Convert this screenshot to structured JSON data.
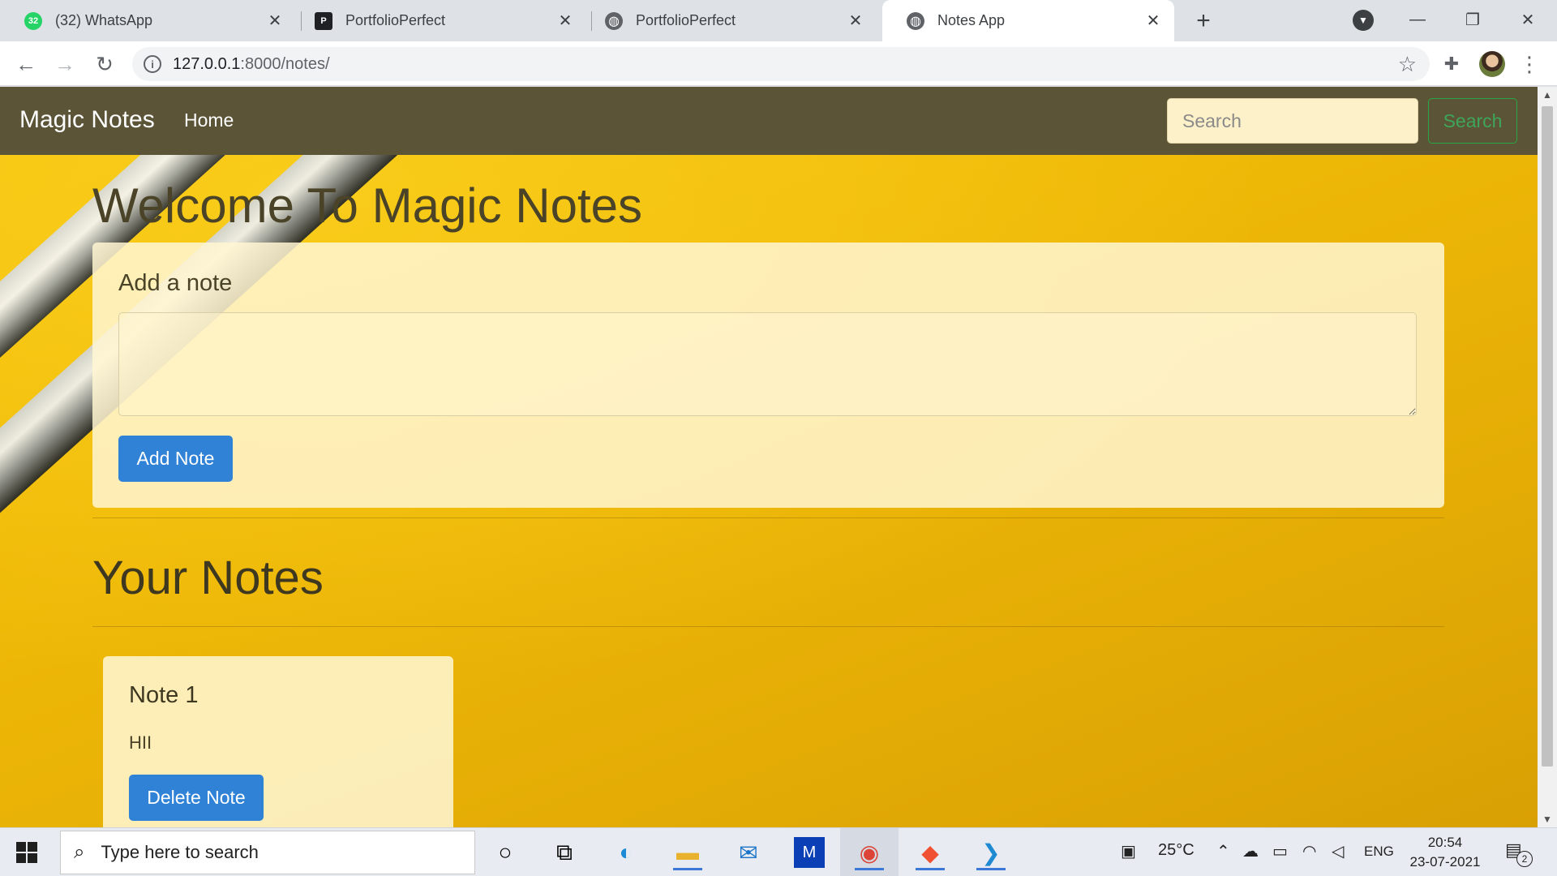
{
  "browser": {
    "tabs": [
      {
        "title": "(32) WhatsApp",
        "badge": "32",
        "favicon": "whatsapp-icon",
        "favicon_color": "#25d366"
      },
      {
        "title": "PortfolioPerfect",
        "badge": "P",
        "favicon": "portfolioperfect-icon",
        "favicon_color": "#202124"
      },
      {
        "title": "PortfolioPerfect",
        "badge": "",
        "favicon": "globe-icon",
        "favicon_color": "#5f6368"
      },
      {
        "title": "Notes App",
        "badge": "",
        "favicon": "globe-icon",
        "favicon_color": "#5f6368"
      }
    ],
    "active_tab": 3,
    "url_host": "127.0.0.1",
    "url_rest": ":8000/notes/"
  },
  "navbar": {
    "brand": "Magic Notes",
    "home_link": "Home",
    "search_placeholder": "Search",
    "search_button": "Search",
    "bg_color": "#5b5436"
  },
  "main": {
    "welcome_heading": "Welcome To Magic Notes",
    "add_card": {
      "title": "Add a note",
      "textarea_value": "",
      "button": "Add Note"
    },
    "notes_heading": "Your Notes",
    "notes": [
      {
        "title": "Note 1",
        "text": "HII",
        "delete_button": "Delete Note"
      }
    ],
    "primary_color": "#2f82d6"
  },
  "taskbar": {
    "search_placeholder": "Type here to search",
    "weather": "25°C",
    "language": "ENG",
    "time": "20:54",
    "date": "23-07-2021",
    "notification_count": "2"
  }
}
